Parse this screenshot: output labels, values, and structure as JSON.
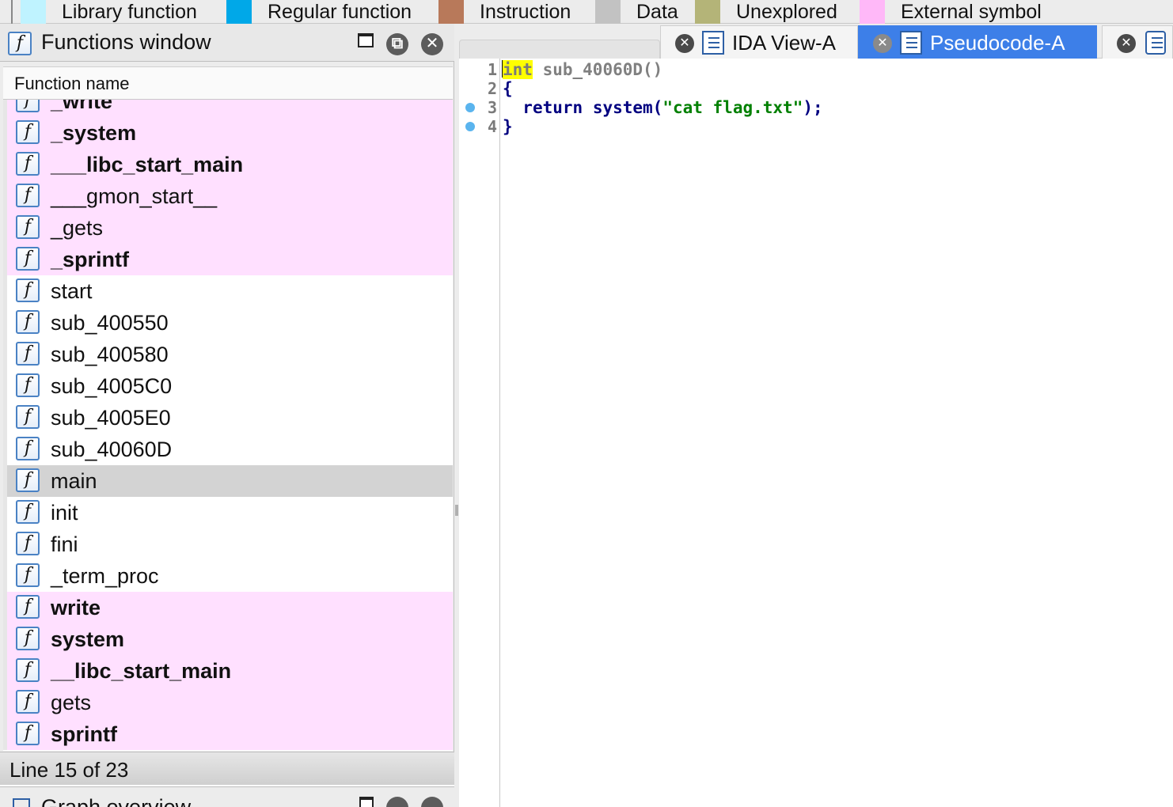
{
  "legend": [
    {
      "label": "Library function",
      "color": "#bff3ff"
    },
    {
      "label": "Regular function",
      "color": "#00a8e8"
    },
    {
      "label": "Instruction",
      "color": "#b8795a"
    },
    {
      "label": "Data",
      "color": "#c2c2c2"
    },
    {
      "label": "Unexplored",
      "color": "#b4b478"
    },
    {
      "label": "External symbol",
      "color": "#ffb8f8"
    }
  ],
  "functions_window": {
    "title": "Functions window",
    "column_header": "Function name",
    "rows": [
      {
        "name": "_write",
        "style": "pink",
        "bold": true
      },
      {
        "name": "_system",
        "style": "pink",
        "bold": true
      },
      {
        "name": "___libc_start_main",
        "style": "pink",
        "bold": true
      },
      {
        "name": "___gmon_start__",
        "style": "pink",
        "bold": false
      },
      {
        "name": "_gets",
        "style": "pink",
        "bold": false
      },
      {
        "name": "_sprintf",
        "style": "pink",
        "bold": true
      },
      {
        "name": "start",
        "style": "plain",
        "bold": false
      },
      {
        "name": "sub_400550",
        "style": "plain",
        "bold": false
      },
      {
        "name": "sub_400580",
        "style": "plain",
        "bold": false
      },
      {
        "name": "sub_4005C0",
        "style": "plain",
        "bold": false
      },
      {
        "name": "sub_4005E0",
        "style": "plain",
        "bold": false
      },
      {
        "name": "sub_40060D",
        "style": "plain",
        "bold": false
      },
      {
        "name": "main",
        "style": "selected",
        "bold": false
      },
      {
        "name": "init",
        "style": "plain",
        "bold": false
      },
      {
        "name": "fini",
        "style": "plain",
        "bold": false
      },
      {
        "name": "_term_proc",
        "style": "plain",
        "bold": false
      },
      {
        "name": "write",
        "style": "pink",
        "bold": true
      },
      {
        "name": "system",
        "style": "pink",
        "bold": true
      },
      {
        "name": "__libc_start_main",
        "style": "pink",
        "bold": true
      },
      {
        "name": "gets",
        "style": "pink",
        "bold": false
      },
      {
        "name": "sprintf",
        "style": "pink",
        "bold": true
      }
    ],
    "status": "Line 15 of 23"
  },
  "graph_overview": {
    "title": "Graph overview"
  },
  "tabs": [
    {
      "label": "IDA View-A",
      "active": false
    },
    {
      "label": "Pseudocode-A",
      "active": true
    },
    {
      "label": "",
      "active": false
    }
  ],
  "code": {
    "line_numbers": [
      "1",
      "2",
      "3",
      "4"
    ],
    "breakpoint_lines": [
      3,
      4
    ],
    "line1_type": "int",
    "line1_rest": " sub_40060D()",
    "line2": "{",
    "line3_indent": "  ",
    "line3_return": "return",
    "line3_func": "system",
    "line3_paren_open": "(",
    "line3_string": "\"cat flag.txt\"",
    "line3_end": ");",
    "line4": "}"
  },
  "colors": {
    "pink_row": "#ffe0ff",
    "selected_row": "#d3d3d3",
    "active_tab": "#3d7fe8",
    "breakpoint": "#5ab4ee"
  }
}
